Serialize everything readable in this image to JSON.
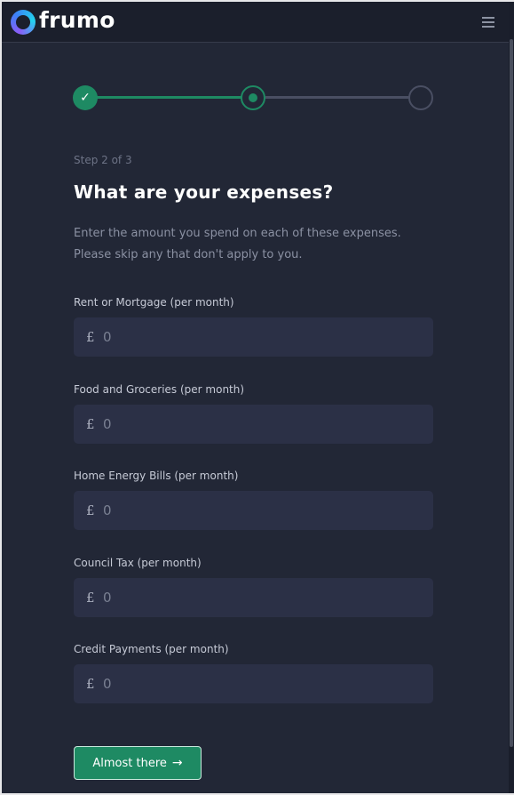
{
  "header": {
    "logo_text": "frumo",
    "menu_icon": "hamburger-menu-icon"
  },
  "stepper": {
    "current_step": 2,
    "total_steps": 3,
    "completed_icon": "checkmark-icon",
    "accent_color": "#1e8a63"
  },
  "form": {
    "step_label": "Step 2 of 3",
    "title": "What are your expenses?",
    "description": "Enter the amount you spend on each of these expenses. Please skip any that don't apply to you.",
    "currency_symbol": "£",
    "fields": [
      {
        "label": "Rent or Mortgage (per month)",
        "placeholder": "0",
        "value": ""
      },
      {
        "label": "Food and Groceries (per month)",
        "placeholder": "0",
        "value": ""
      },
      {
        "label": "Home Energy Bills (per month)",
        "placeholder": "0",
        "value": ""
      },
      {
        "label": "Council Tax (per month)",
        "placeholder": "0",
        "value": ""
      },
      {
        "label": "Credit Payments (per month)",
        "placeholder": "0",
        "value": ""
      }
    ],
    "submit_label": "Almost there",
    "submit_icon": "arrow-right-icon"
  }
}
